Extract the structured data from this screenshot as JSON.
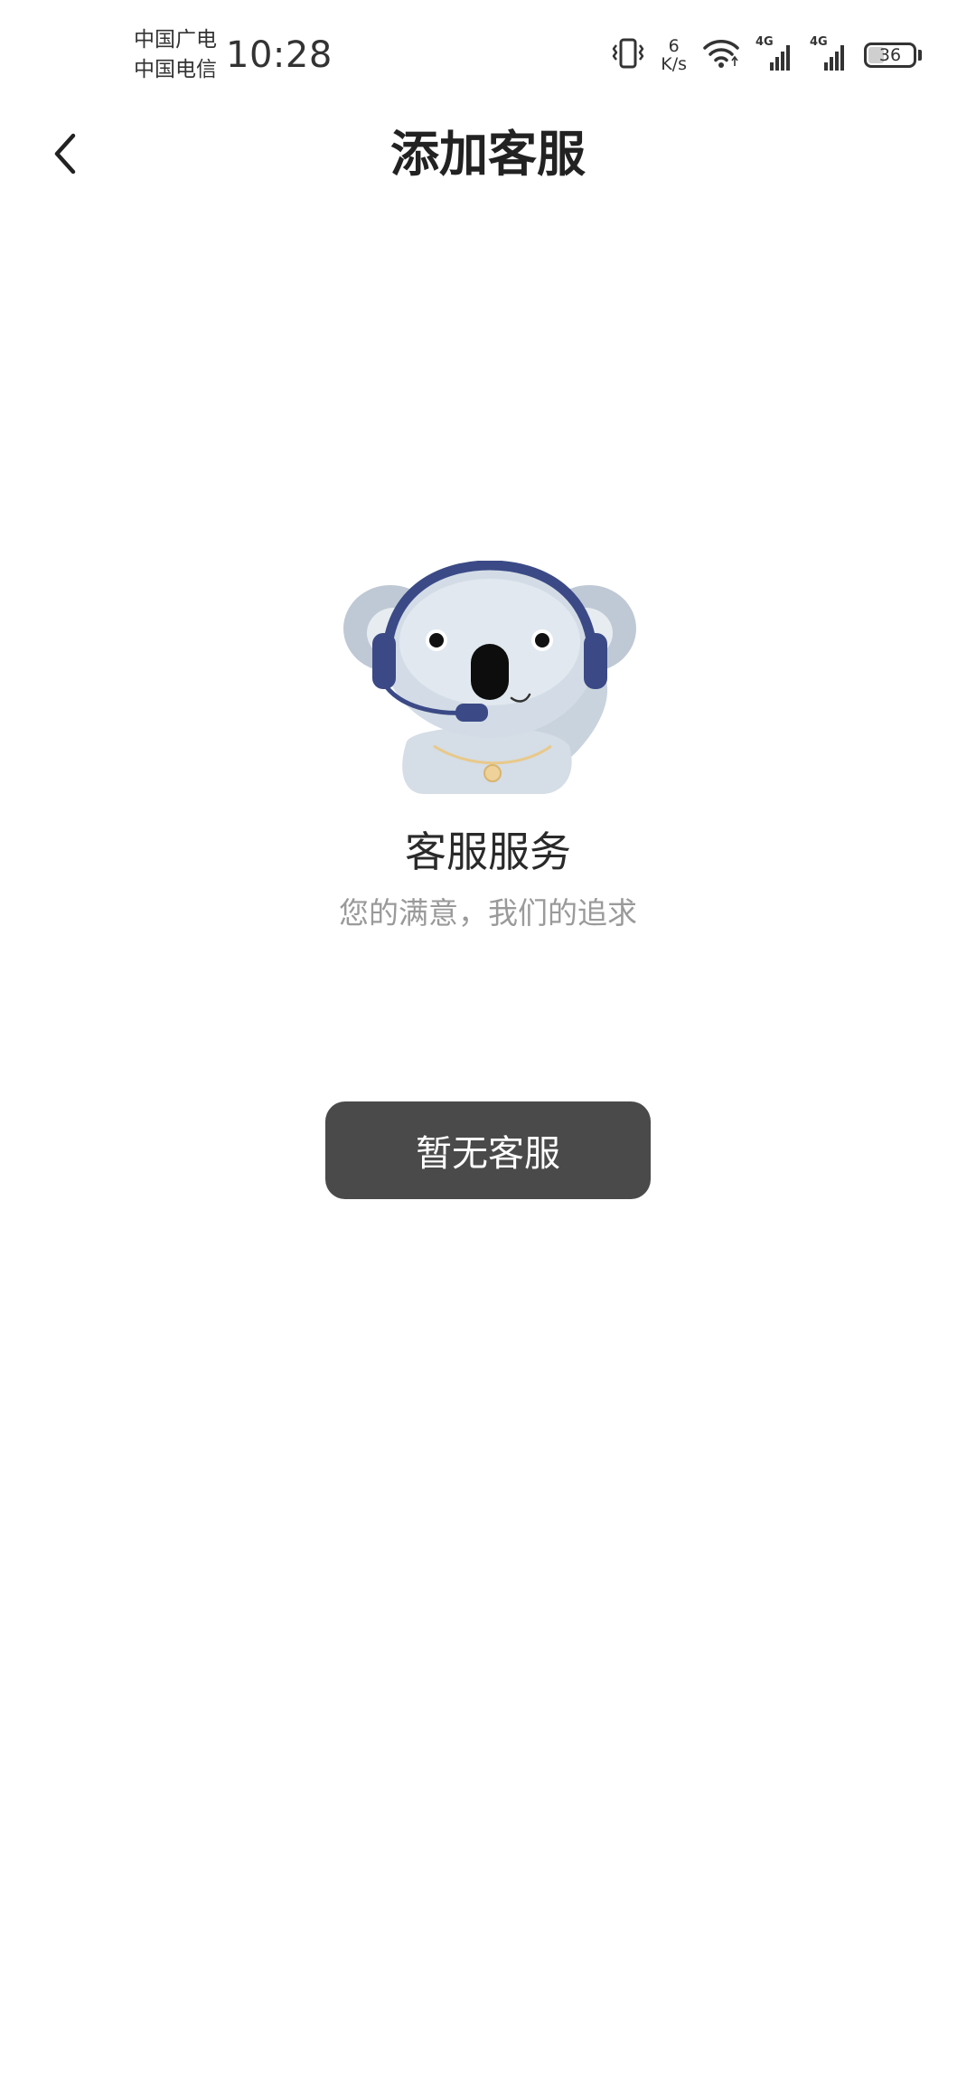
{
  "status_bar": {
    "carrier_1": "中国广电",
    "carrier_2": "中国电信",
    "time": "10:28",
    "net_speed_value": "6",
    "net_speed_unit": "K/s",
    "signal_1_tag": "4G",
    "signal_2_tag": "4G",
    "battery_level": "36",
    "battery_fraction": 0.36
  },
  "nav": {
    "title": "添加客服",
    "back_icon": "chevron-left-icon"
  },
  "hero": {
    "illustration": "koala-headset-mascot",
    "title": "客服服务",
    "subtitle": "您的满意，我们的追求"
  },
  "action": {
    "button_label": "暂无客服"
  },
  "colors": {
    "background": "#ffffff",
    "text_primary": "#222222",
    "text_secondary": "#9a9a9a",
    "button_bg": "#4a4a4a",
    "button_text": "#ffffff",
    "mascot_fur": "#c9d3de",
    "mascot_headset": "#3b4a86"
  }
}
